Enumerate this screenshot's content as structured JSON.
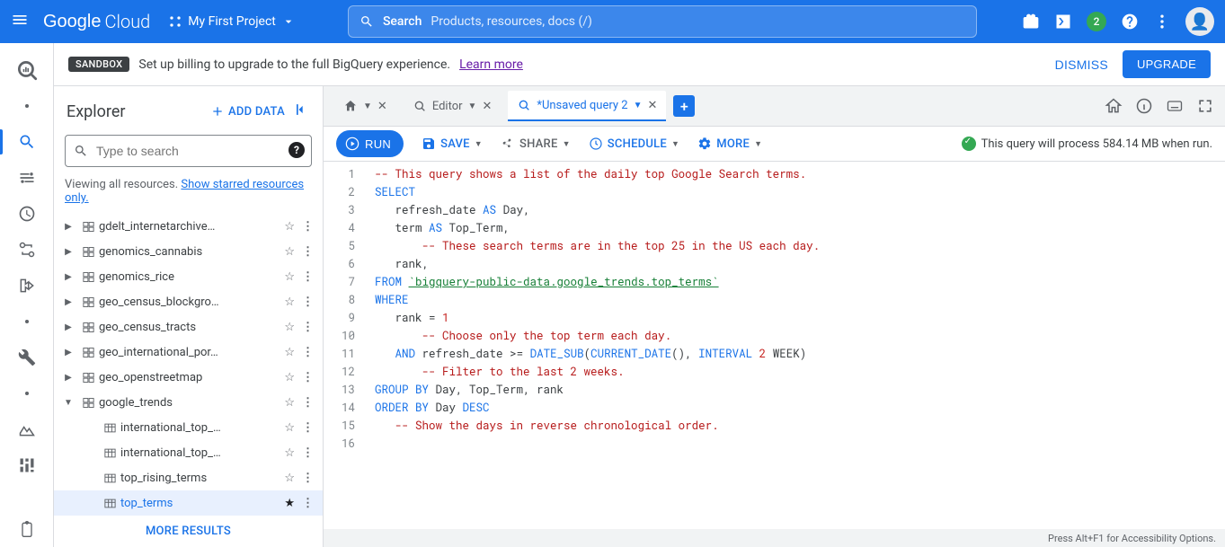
{
  "header": {
    "logo_google": "Google",
    "logo_cloud": "Cloud",
    "project_name": "My First Project",
    "search_label": "Search",
    "search_placeholder": "Products, resources, docs (/)",
    "notification_count": "2"
  },
  "banner": {
    "chip": "SANDBOX",
    "text": "Set up billing to upgrade to the full BigQuery experience.",
    "learn_more": "Learn more",
    "dismiss": "DISMISS",
    "upgrade": "UPGRADE"
  },
  "explorer": {
    "title": "Explorer",
    "add_data": "ADD DATA",
    "search_placeholder": "Type to search",
    "viewing_prefix": "Viewing all resources.",
    "show_starred": "Show starred resources only.",
    "more_results": "MORE RESULTS",
    "datasets": [
      {
        "name": "gdelt_internetarchive…",
        "expanded": false,
        "starred": false
      },
      {
        "name": "genomics_cannabis",
        "expanded": false,
        "starred": false
      },
      {
        "name": "genomics_rice",
        "expanded": false,
        "starred": false
      },
      {
        "name": "geo_census_blockgro…",
        "expanded": false,
        "starred": false
      },
      {
        "name": "geo_census_tracts",
        "expanded": false,
        "starred": false
      },
      {
        "name": "geo_international_por…",
        "expanded": false,
        "starred": false
      },
      {
        "name": "geo_openstreetmap",
        "expanded": false,
        "starred": false
      },
      {
        "name": "google_trends",
        "expanded": true,
        "starred": false,
        "tables": [
          {
            "name": "international_top_…",
            "starred": false,
            "selected": false
          },
          {
            "name": "international_top_…",
            "starred": false,
            "selected": false
          },
          {
            "name": "top_rising_terms",
            "starred": false,
            "selected": false
          },
          {
            "name": "top_terms",
            "starred": true,
            "selected": true
          }
        ]
      }
    ]
  },
  "tabs": {
    "home_label": "",
    "editor_label": "Editor",
    "query_label": "*Unsaved query 2",
    "add": "+"
  },
  "toolbar": {
    "run": "RUN",
    "save": "SAVE",
    "share": "SHARE",
    "schedule": "SCHEDULE",
    "more": "MORE",
    "status": "This query will process 584.14 MB when run."
  },
  "code": {
    "lines": 16,
    "l1": "-- This query shows a list of the daily top Google Search terms.",
    "l2_kw": "SELECT",
    "l3a": "   refresh_date ",
    "l3kw": "AS",
    "l3b": " Day,",
    "l4a": "   term ",
    "l4kw": "AS",
    "l4b": " Top_Term,",
    "l5": "       -- These search terms are in the top 25 in the US each day.",
    "l6": "   rank,",
    "l7kw": "FROM ",
    "l7s": "`bigquery-public-data.google_trends.top_terms`",
    "l8kw": "WHERE",
    "l9a": "   rank = ",
    "l9n": "1",
    "l10": "       -- Choose only the top term each day.",
    "l11a": "   ",
    "l11kw1": "AND",
    "l11b": " refresh_date >= ",
    "l11f1": "DATE_SUB",
    "l11c": "(",
    "l11f2": "CURRENT_DATE",
    "l11d": "(), ",
    "l11kw2": "INTERVAL",
    "l11e": " ",
    "l11n": "2",
    "l11g": " WEEK)",
    "l12": "       -- Filter to the last 2 weeks.",
    "l13kw": "GROUP BY",
    "l13b": " Day, Top_Term, rank",
    "l14kw": "ORDER BY",
    "l14b": " Day ",
    "l14kw2": "DESC",
    "l15": "   -- Show the days in reverse chronological order."
  },
  "footer": {
    "hint": "Press Alt+F1 for Accessibility Options."
  }
}
